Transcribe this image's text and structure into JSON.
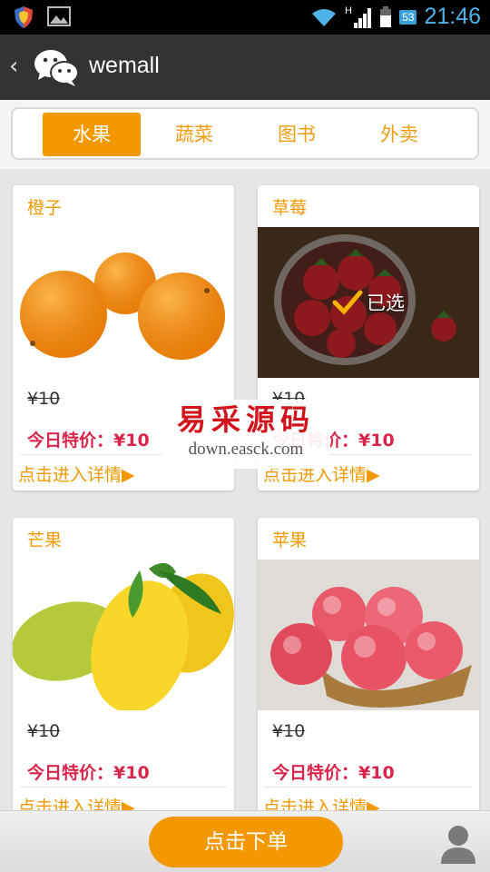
{
  "status": {
    "time": "21:46",
    "battery": "53",
    "network": "H"
  },
  "app": {
    "title": "wemall"
  },
  "tabs": [
    {
      "label": "水果",
      "active": true
    },
    {
      "label": "蔬菜",
      "active": false
    },
    {
      "label": "图书",
      "active": false
    },
    {
      "label": "外卖",
      "active": false
    }
  ],
  "products": [
    {
      "name": "橙子",
      "orig": "¥10",
      "sale": "今日特价：¥10",
      "detail": "点击进入详情",
      "image": "orange-image",
      "selected": false
    },
    {
      "name": "草莓",
      "orig": "¥10",
      "sale": "今日特价：¥10",
      "detail": "点击进入详情",
      "image": "strawberry-image",
      "selected": true,
      "selected_label": "已选"
    },
    {
      "name": "芒果",
      "orig": "¥10",
      "sale": "今日特价：¥10",
      "detail": "点击进入详情",
      "image": "mango-image",
      "selected": false
    },
    {
      "name": "苹果",
      "orig": "¥10",
      "sale": "今日特价：¥10",
      "detail": "点击进入详情",
      "image": "apple-image",
      "selected": false
    }
  ],
  "watermark": {
    "cn": "易采源码",
    "en": "down.easck.com"
  },
  "bottom": {
    "order_label": "点击下单"
  },
  "colors": {
    "accent": "#f39800",
    "sale": "#d9254a",
    "action_bar": "#333333"
  }
}
